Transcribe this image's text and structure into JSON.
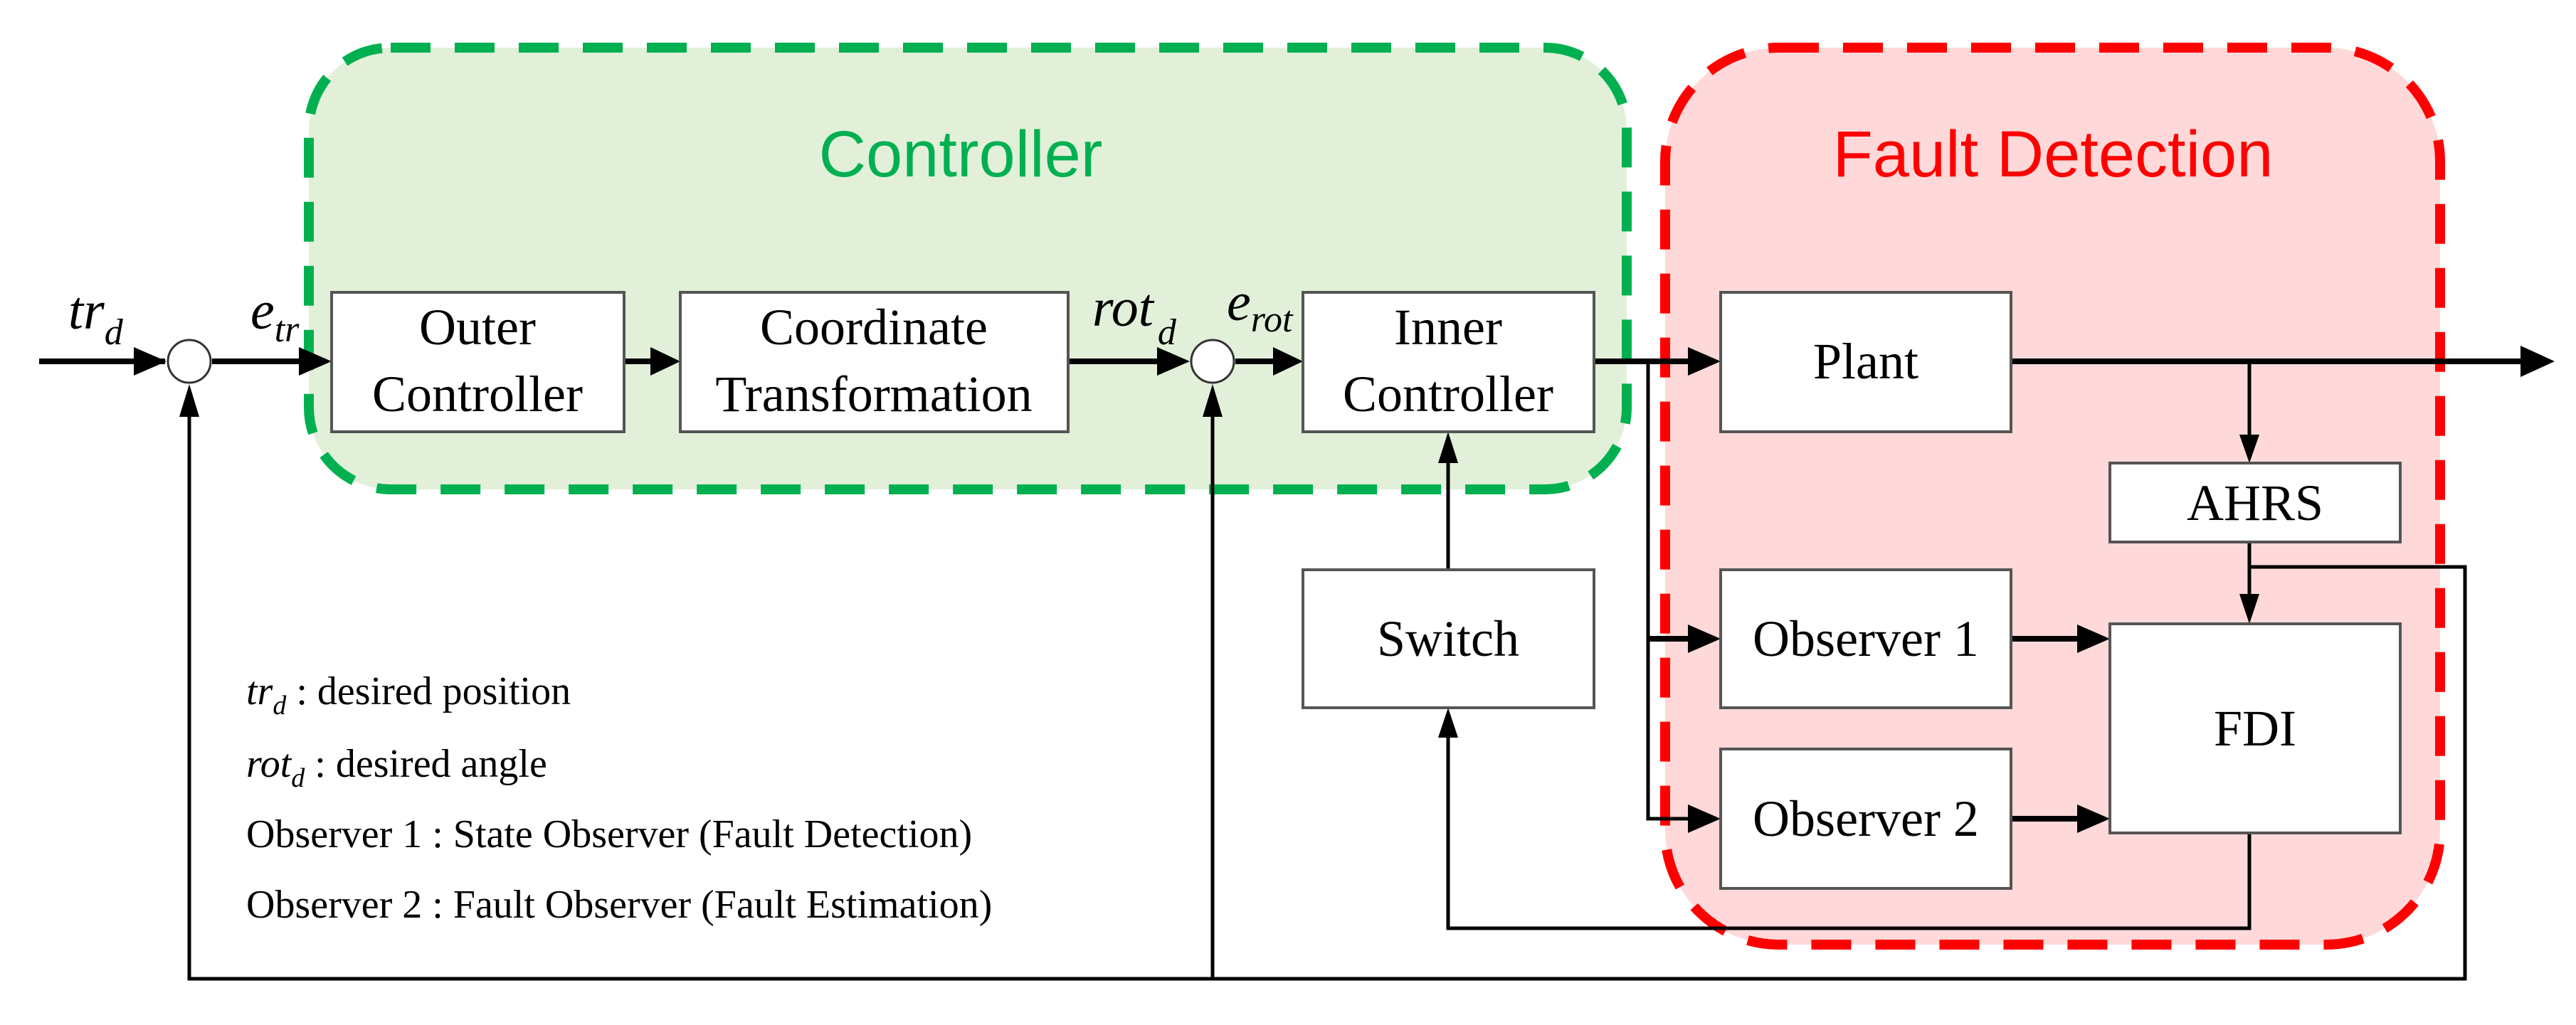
{
  "groups": {
    "controller": {
      "title": "Controller",
      "color": "#00b050",
      "fill": "#e2f0d9"
    },
    "fault_detection": {
      "title": "Fault Detection",
      "color": "#ff0000",
      "fill": "#ffd9d9"
    }
  },
  "blocks": {
    "outer_controller": [
      "Outer",
      "Controller"
    ],
    "coordinate_transformation": [
      "Coordinate",
      "Transformation"
    ],
    "inner_controller": [
      "Inner",
      "Controller"
    ],
    "plant": "Plant",
    "ahrs": "AHRS",
    "switch": "Switch",
    "observer1": "Observer 1",
    "observer2": "Observer 2",
    "fdi": "FDI"
  },
  "signals": {
    "tr_d": {
      "base": "tr",
      "sub": "d"
    },
    "e_tr": {
      "base": "e",
      "sub": "tr"
    },
    "rot_d": {
      "base": "rot",
      "sub": "d"
    },
    "e_rot": {
      "base": "e",
      "sub": "rot"
    }
  },
  "legend": [
    {
      "sym": "tr",
      "sub": "d",
      "text": " :  desired position"
    },
    {
      "sym": "rot",
      "sub": "d",
      "text": " :  desired angle"
    },
    {
      "sym": "",
      "sub": "",
      "text": "Observer 1 : State Observer (Fault Detection)"
    },
    {
      "sym": "",
      "sub": "",
      "text": "Observer 2 : Fault Observer (Fault Estimation)"
    }
  ]
}
